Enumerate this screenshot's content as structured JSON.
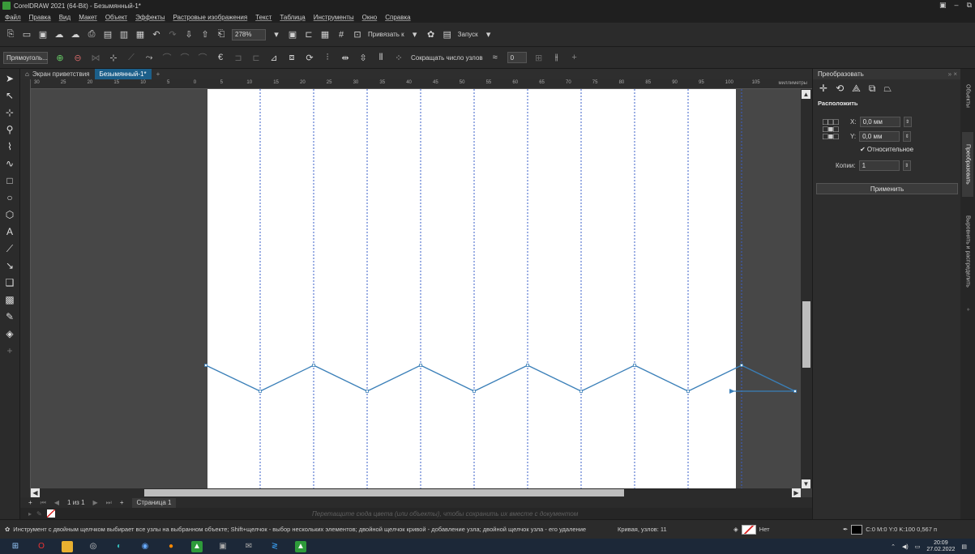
{
  "window": {
    "title": "CorelDRAW 2021 (64-Bit) - Безымянный-1*",
    "controls": [
      "▣",
      "–",
      "⧉"
    ]
  },
  "menu": [
    "Файл",
    "Правка",
    "Вид",
    "Макет",
    "Объект",
    "Эффекты",
    "Растровые изображения",
    "Текст",
    "Таблица",
    "Инструменты",
    "Окно",
    "Справка"
  ],
  "toolbar": {
    "zoom": "278%",
    "snap_label": "Привязать к",
    "launch_label": "Запуск"
  },
  "property_bar": {
    "shape_select": "Прямоуголь...",
    "reduce_nodes_label": "Сокращать число узлов",
    "smoothing_value": "0"
  },
  "doc_tabs": {
    "welcome": "Экран приветствия",
    "document": "Безымянный-1*"
  },
  "ruler": {
    "unit": "миллиметры",
    "ticks": [
      "30",
      "25",
      "20",
      "15",
      "10",
      "5",
      "0",
      "5",
      "10",
      "15",
      "20",
      "25",
      "30",
      "35",
      "40",
      "45",
      "50",
      "55",
      "60",
      "65",
      "70",
      "75",
      "80",
      "85",
      "90",
      "95",
      "100",
      "105"
    ]
  },
  "page_nav": {
    "page_of": "1 из 1",
    "page_tab": "Страница 1"
  },
  "color_hint": "Перетащите сюда цвета (или объекты), чтобы сохранить их вместе с документом",
  "status": {
    "hint": "Инструмент с двойным щелчком выбирает все узлы на выбранном объекте; Shift+щелчок - выбор нескольких элементов; двойной щелчок кривой - добавление узла; двойной щелчок узла - его удаление",
    "curve_info": "Кривая, узлов: 11",
    "fill": "Нет",
    "outline": "C:0 M:0 Y:0 K:100  0,567 п"
  },
  "taskbar": {
    "time": "20:09",
    "date": "27.02.2022"
  },
  "docker": {
    "title": "Преобразовать",
    "section": "Расположить",
    "x_label": "X:",
    "x_value": "0,0 мм",
    "y_label": "Y:",
    "y_value": "0,0 мм",
    "relative_label": "✔ Относительное",
    "copies_label": "Копии:",
    "copies_value": "1",
    "apply_label": "Применить",
    "side_tabs": [
      "Объекты",
      "Преобразовать",
      "Выровнять и распределить"
    ]
  },
  "colors": {
    "accent": "#1c5f8a",
    "curve": "#3a7fb8",
    "guides": "#3a5fc8"
  },
  "canvas": {
    "guide_count": 10,
    "zigzag_peaks": 5
  }
}
